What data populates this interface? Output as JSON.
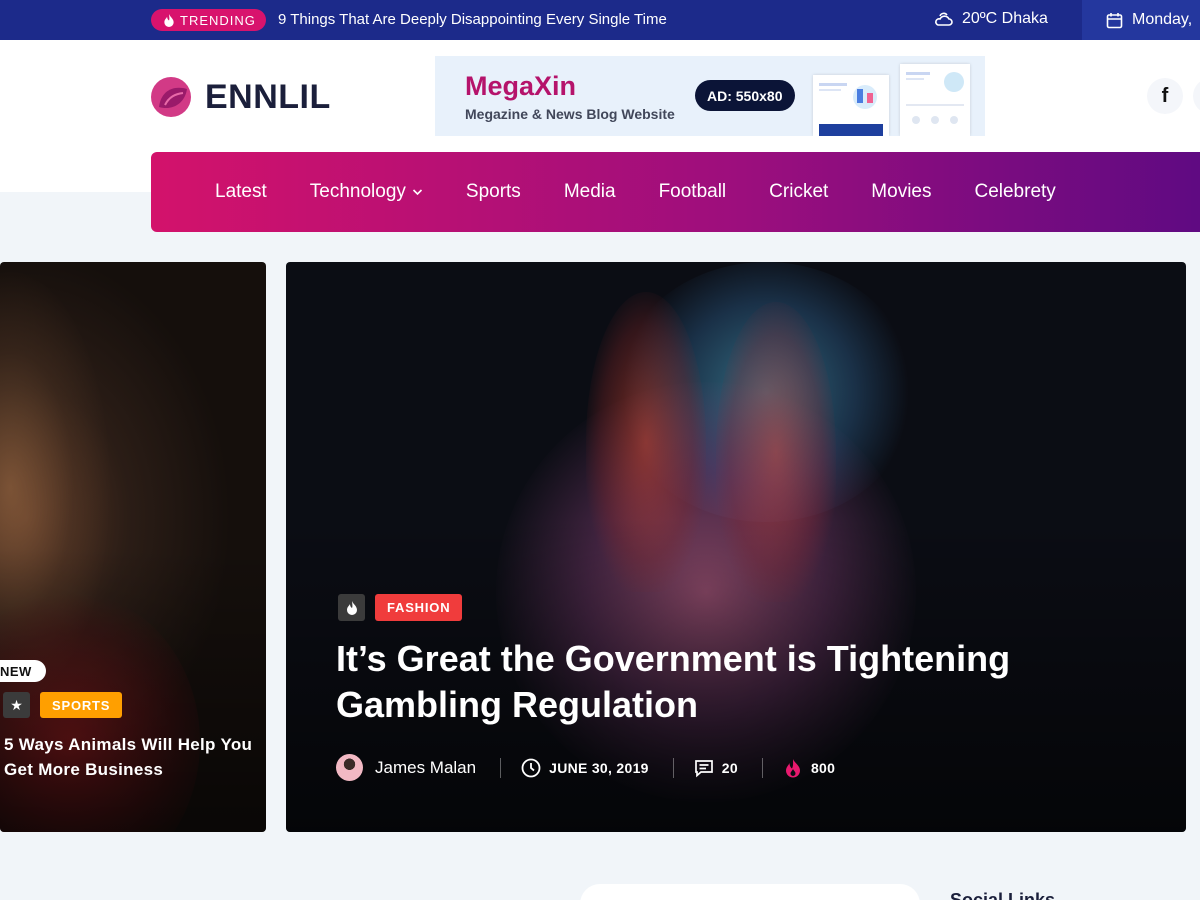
{
  "topbar": {
    "trending_label": "TRENDING",
    "trending_headline": "9 Things That Are Deeply Disappointing Every Single Time",
    "weather": "20ºC  Dhaka",
    "date": "Monday, "
  },
  "header": {
    "logo_text": "ENNLIL",
    "ad": {
      "title": "MegaXin",
      "subtitle": "Megazine & News Blog Website",
      "badge": "AD: 550x80"
    },
    "social_facebook": "f"
  },
  "nav": {
    "items": [
      {
        "label": "Latest"
      },
      {
        "label": "Technology"
      },
      {
        "label": "Sports"
      },
      {
        "label": "Media"
      },
      {
        "label": "Football"
      },
      {
        "label": "Cricket"
      },
      {
        "label": "Movies"
      },
      {
        "label": "Celebrety"
      }
    ]
  },
  "slider": {
    "left_card": {
      "new_label": "NEW",
      "category": "SPORTS",
      "title": "5 Ways Animals Will Help You Get More Business"
    },
    "main_card": {
      "category": "FASHION",
      "title": "It’s Great the Government is Tightening Gambling Regulation",
      "author": "James Malan",
      "date": "JUNE 30, 2019",
      "comments": "20",
      "views": "800"
    }
  },
  "sidebar": {
    "social_heading": "Social Links"
  },
  "colors": {
    "topbar": "#1c2a8a",
    "brand_pink": "#d8136d",
    "nav_start": "#d3126b",
    "nav_end": "#5e0a82",
    "sports_tag": "#ff9f00",
    "fashion_tag": "#f03c3c"
  }
}
